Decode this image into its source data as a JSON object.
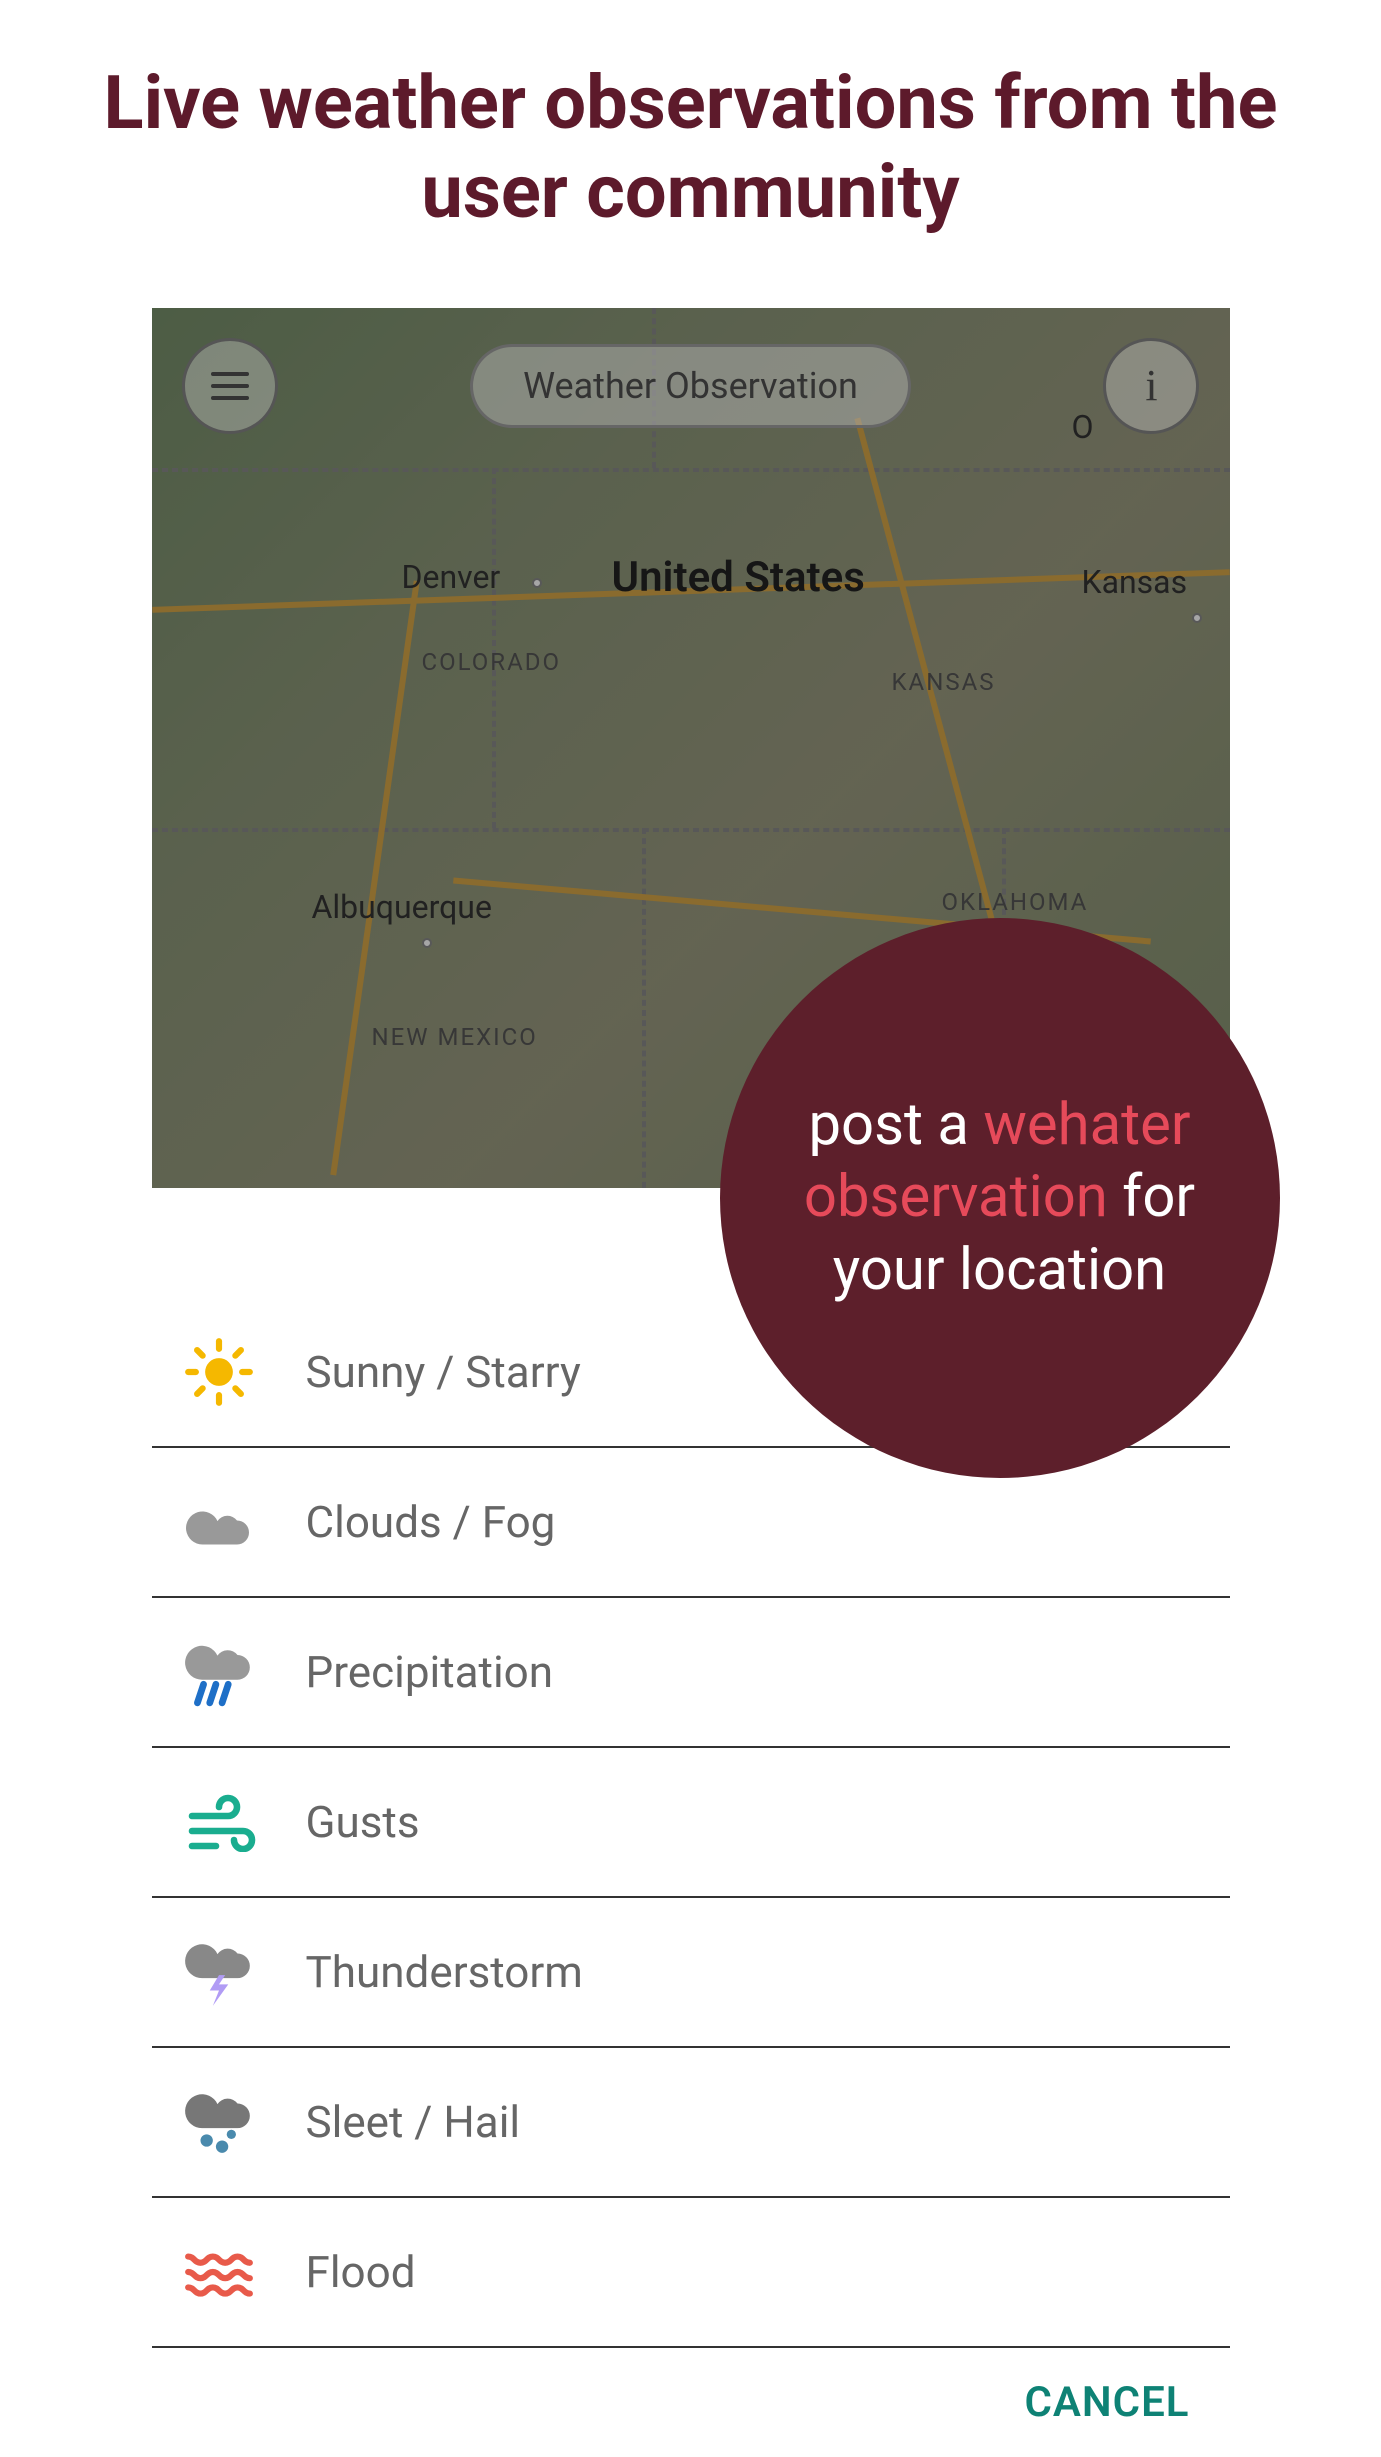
{
  "header": {
    "title": "Live weather observations from the user community"
  },
  "map": {
    "pill_label": "Weather Observation",
    "country": "United States",
    "cities": {
      "denver": "Denver",
      "kansas": "Kansas",
      "albuquerque": "Albuquerque",
      "omaha_partial": "O"
    },
    "states": {
      "colorado": "COLORADO",
      "kansas": "KANSAS",
      "oklahoma": "OKLAHOMA",
      "new_mexico": "NEW MEXICO"
    }
  },
  "callout": {
    "pre": "post a ",
    "highlight": "wehater observation",
    "post": " for your location"
  },
  "weather_options": [
    {
      "icon": "sun",
      "label": "Sunny / Starry"
    },
    {
      "icon": "cloud",
      "label": "Clouds / Fog"
    },
    {
      "icon": "rain",
      "label": "Precipitation"
    },
    {
      "icon": "wind",
      "label": "Gusts"
    },
    {
      "icon": "storm",
      "label": "Thunderstorm"
    },
    {
      "icon": "sleet",
      "label": "Sleet / Hail"
    },
    {
      "icon": "flood",
      "label": "Flood"
    }
  ],
  "actions": {
    "cancel": "CANCEL"
  },
  "icons": {
    "hamburger": "menu-icon",
    "info": "info-icon"
  }
}
